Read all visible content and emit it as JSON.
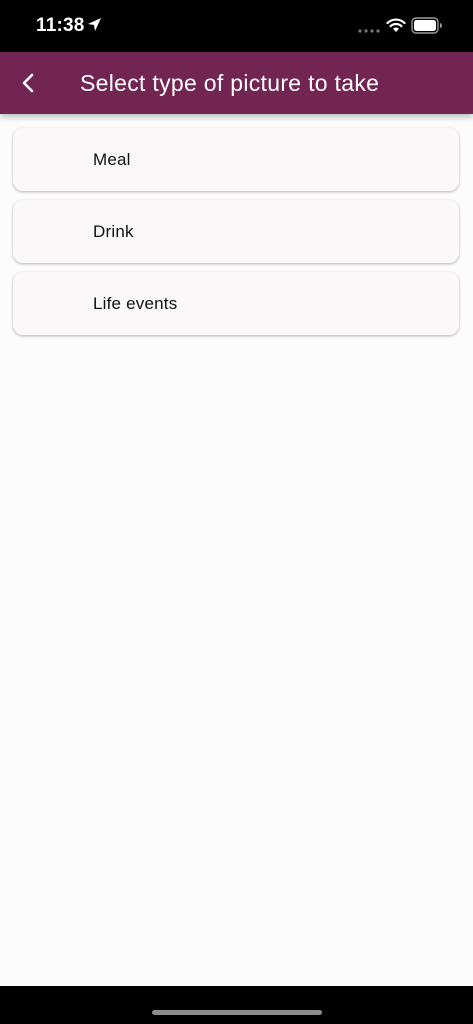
{
  "status_bar": {
    "time": "11:38"
  },
  "app_bar": {
    "title": "Select type of picture to take",
    "color": "#722553"
  },
  "options": [
    {
      "label": "Meal"
    },
    {
      "label": "Drink"
    },
    {
      "label": "Life events"
    }
  ]
}
